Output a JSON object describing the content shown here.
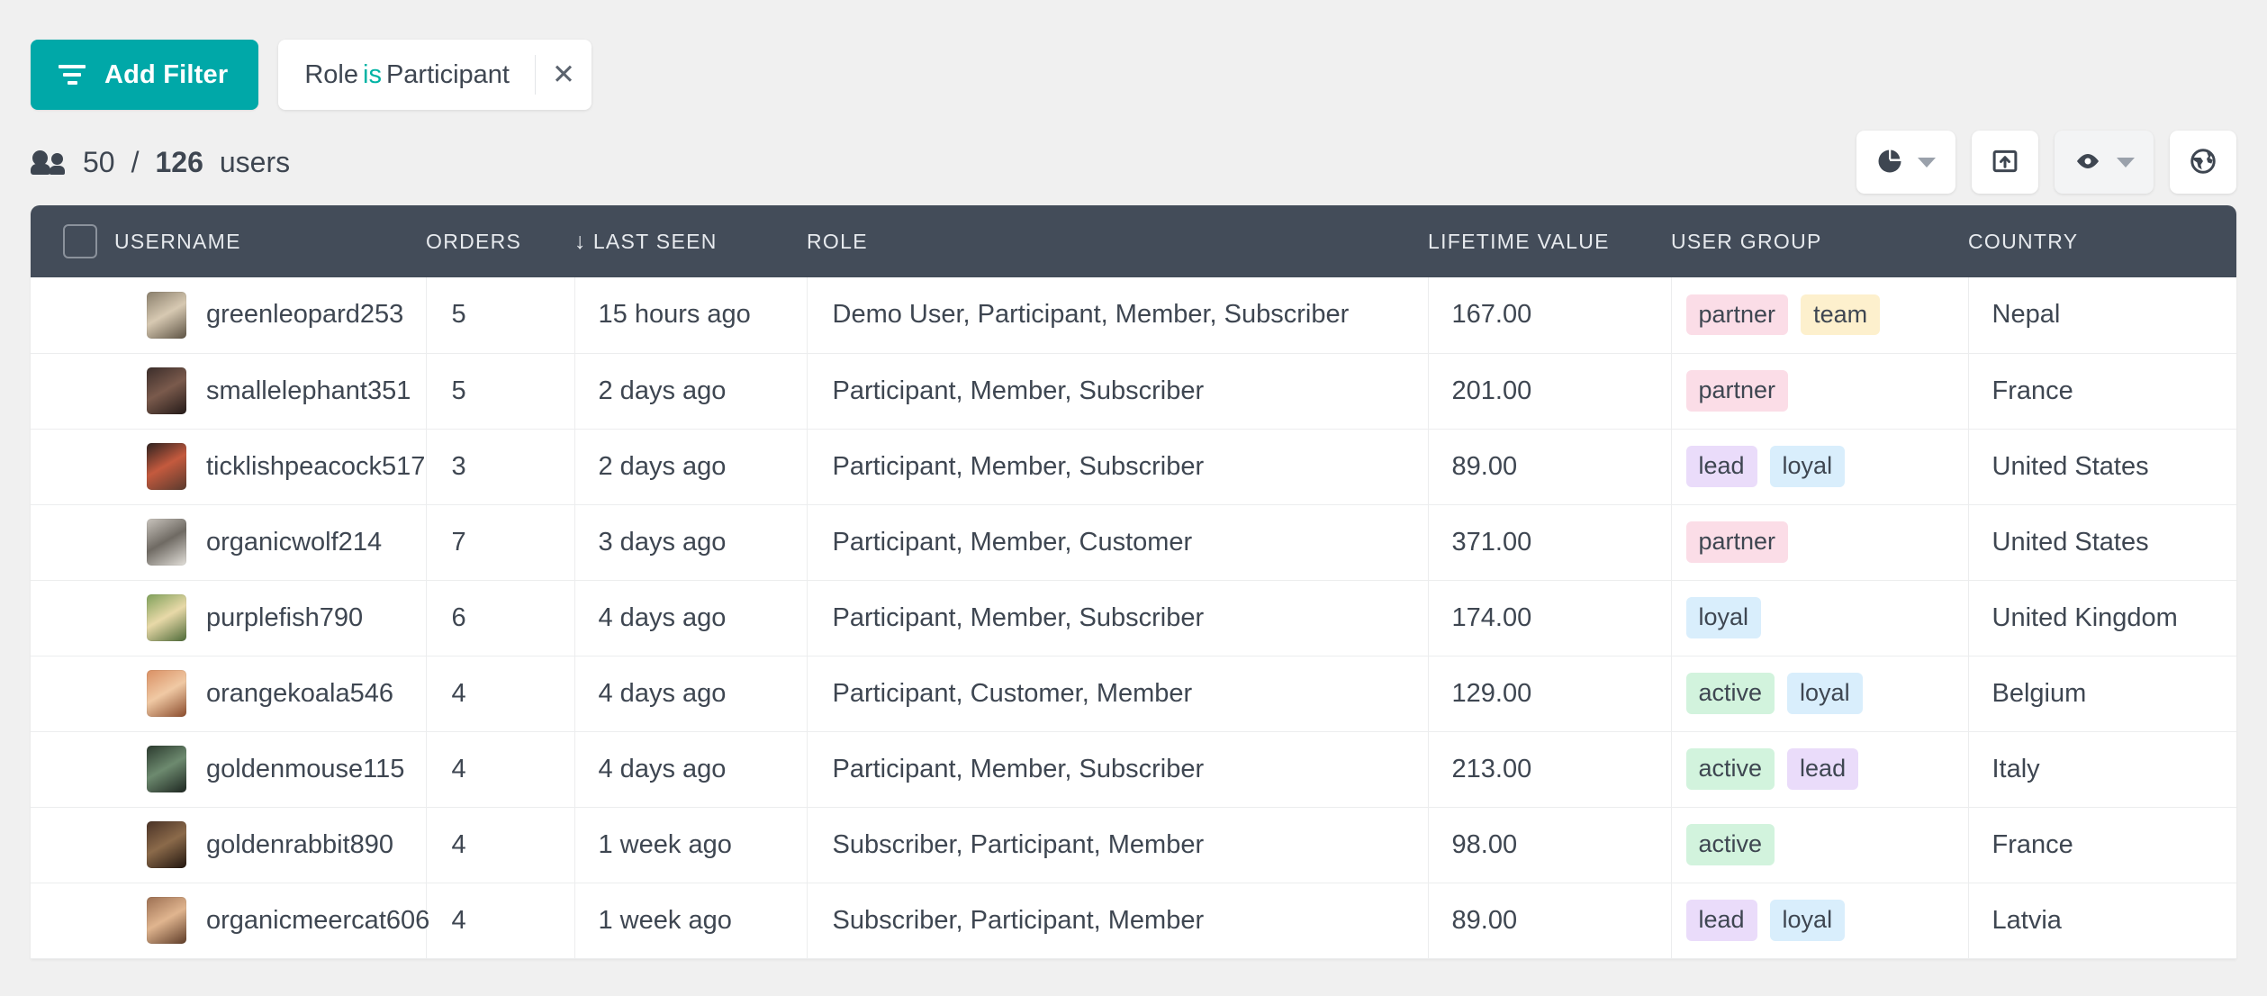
{
  "toolbar": {
    "add_filter_label": "Add Filter",
    "filter_chip": {
      "field": "Role",
      "operator": "is",
      "value": "Participant",
      "close_glyph": "✕"
    }
  },
  "summary": {
    "shown": "50",
    "separator": "/",
    "total": "126",
    "unit": "users"
  },
  "actions": [
    {
      "name": "chart-button",
      "icon": "pie-chart-icon",
      "has_caret": true,
      "muted": false
    },
    {
      "name": "export-button",
      "icon": "export-box-icon",
      "has_caret": false,
      "muted": false
    },
    {
      "name": "visibility-button",
      "icon": "eye-icon",
      "has_caret": true,
      "muted": true
    },
    {
      "name": "globe-button",
      "icon": "globe-icon",
      "has_caret": false,
      "muted": false
    }
  ],
  "table": {
    "columns": [
      {
        "key": "checkbox",
        "label": ""
      },
      {
        "key": "username",
        "label": "USERNAME",
        "sorted": false
      },
      {
        "key": "orders",
        "label": "ORDERS",
        "sorted": false
      },
      {
        "key": "last_seen",
        "label": "LAST SEEN",
        "sorted": true,
        "sort_glyph": "↓"
      },
      {
        "key": "role",
        "label": "ROLE",
        "sorted": false
      },
      {
        "key": "lifetime_value",
        "label": "LIFETIME VALUE",
        "sorted": false
      },
      {
        "key": "user_group",
        "label": "USER GROUP",
        "sorted": false
      },
      {
        "key": "country",
        "label": "COUNTRY",
        "sorted": false
      }
    ],
    "rows": [
      {
        "username": "greenleopard253",
        "orders": "5",
        "last_seen": "15 hours ago",
        "role": "Demo User, Participant, Member, Subscriber",
        "lifetime_value": "167.00",
        "tags": [
          {
            "label": "partner",
            "color": "#fbdde7"
          },
          {
            "label": "team",
            "color": "#fdf0cd"
          }
        ],
        "country": "Nepal",
        "avatar_colors": [
          "#8a7f6c",
          "#d7c9b2",
          "#5d5344"
        ]
      },
      {
        "username": "smallelephant351",
        "orders": "5",
        "last_seen": "2 days ago",
        "role": "Participant, Member, Subscriber",
        "lifetime_value": "201.00",
        "tags": [
          {
            "label": "partner",
            "color": "#fbdde7"
          }
        ],
        "country": "France",
        "avatar_colors": [
          "#3b2d2a",
          "#7a5a4c",
          "#241a18"
        ]
      },
      {
        "username": "ticklishpeacock517",
        "orders": "3",
        "last_seen": "2 days ago",
        "role": "Participant, Member, Subscriber",
        "lifetime_value": "89.00",
        "tags": [
          {
            "label": "lead",
            "color": "#eadcfa"
          },
          {
            "label": "loyal",
            "color": "#d9eefc"
          }
        ],
        "country": "United States",
        "avatar_colors": [
          "#2e2220",
          "#c45a3e",
          "#5a3a2e"
        ]
      },
      {
        "username": "organicwolf214",
        "orders": "7",
        "last_seen": "3 days ago",
        "role": "Participant, Member, Customer",
        "lifetime_value": "371.00",
        "tags": [
          {
            "label": "partner",
            "color": "#fbdde7"
          }
        ],
        "country": "United States",
        "avatar_colors": [
          "#c9c4bd",
          "#6f6a63",
          "#e3e0da"
        ]
      },
      {
        "username": "purplefish790",
        "orders": "6",
        "last_seen": "4 days ago",
        "role": "Participant, Member, Subscriber",
        "lifetime_value": "174.00",
        "tags": [
          {
            "label": "loyal",
            "color": "#d9eefc"
          }
        ],
        "country": "United Kingdom",
        "avatar_colors": [
          "#7fa05a",
          "#e8d9a8",
          "#4e6b39"
        ]
      },
      {
        "username": "orangekoala546",
        "orders": "4",
        "last_seen": "4 days ago",
        "role": "Participant, Customer, Member",
        "lifetime_value": "129.00",
        "tags": [
          {
            "label": "active",
            "color": "#d2f3dd"
          },
          {
            "label": "loyal",
            "color": "#d9eefc"
          }
        ],
        "country": "Belgium",
        "avatar_colors": [
          "#d98f63",
          "#f0c9a4",
          "#8a4b2c"
        ]
      },
      {
        "username": "goldenmouse115",
        "orders": "4",
        "last_seen": "4 days ago",
        "role": "Participant, Member, Subscriber",
        "lifetime_value": "213.00",
        "tags": [
          {
            "label": "active",
            "color": "#d2f3dd"
          },
          {
            "label": "lead",
            "color": "#eadcfa"
          }
        ],
        "country": "Italy",
        "avatar_colors": [
          "#2b3a2e",
          "#6d8a6f",
          "#1d2620"
        ]
      },
      {
        "username": "goldenrabbit890",
        "orders": "4",
        "last_seen": "1 week ago",
        "role": "Subscriber, Participant, Member",
        "lifetime_value": "98.00",
        "tags": [
          {
            "label": "active",
            "color": "#d2f3dd"
          }
        ],
        "country": "France",
        "avatar_colors": [
          "#4a3226",
          "#8b6a4a",
          "#22160f"
        ]
      },
      {
        "username": "organicmeercat606",
        "orders": "4",
        "last_seen": "1 week ago",
        "role": "Subscriber, Participant, Member",
        "lifetime_value": "89.00",
        "tags": [
          {
            "label": "lead",
            "color": "#eadcfa"
          },
          {
            "label": "loyal",
            "color": "#d9eefc"
          }
        ],
        "country": "Latvia",
        "avatar_colors": [
          "#9c6f52",
          "#e0b58f",
          "#5e3c28"
        ]
      }
    ]
  },
  "colors": {
    "accent": "#00a8a8",
    "chip_operator": "#00b3a4",
    "header_bg": "#434c59",
    "text": "#3e4651",
    "page_bg": "#f0f0f0"
  }
}
